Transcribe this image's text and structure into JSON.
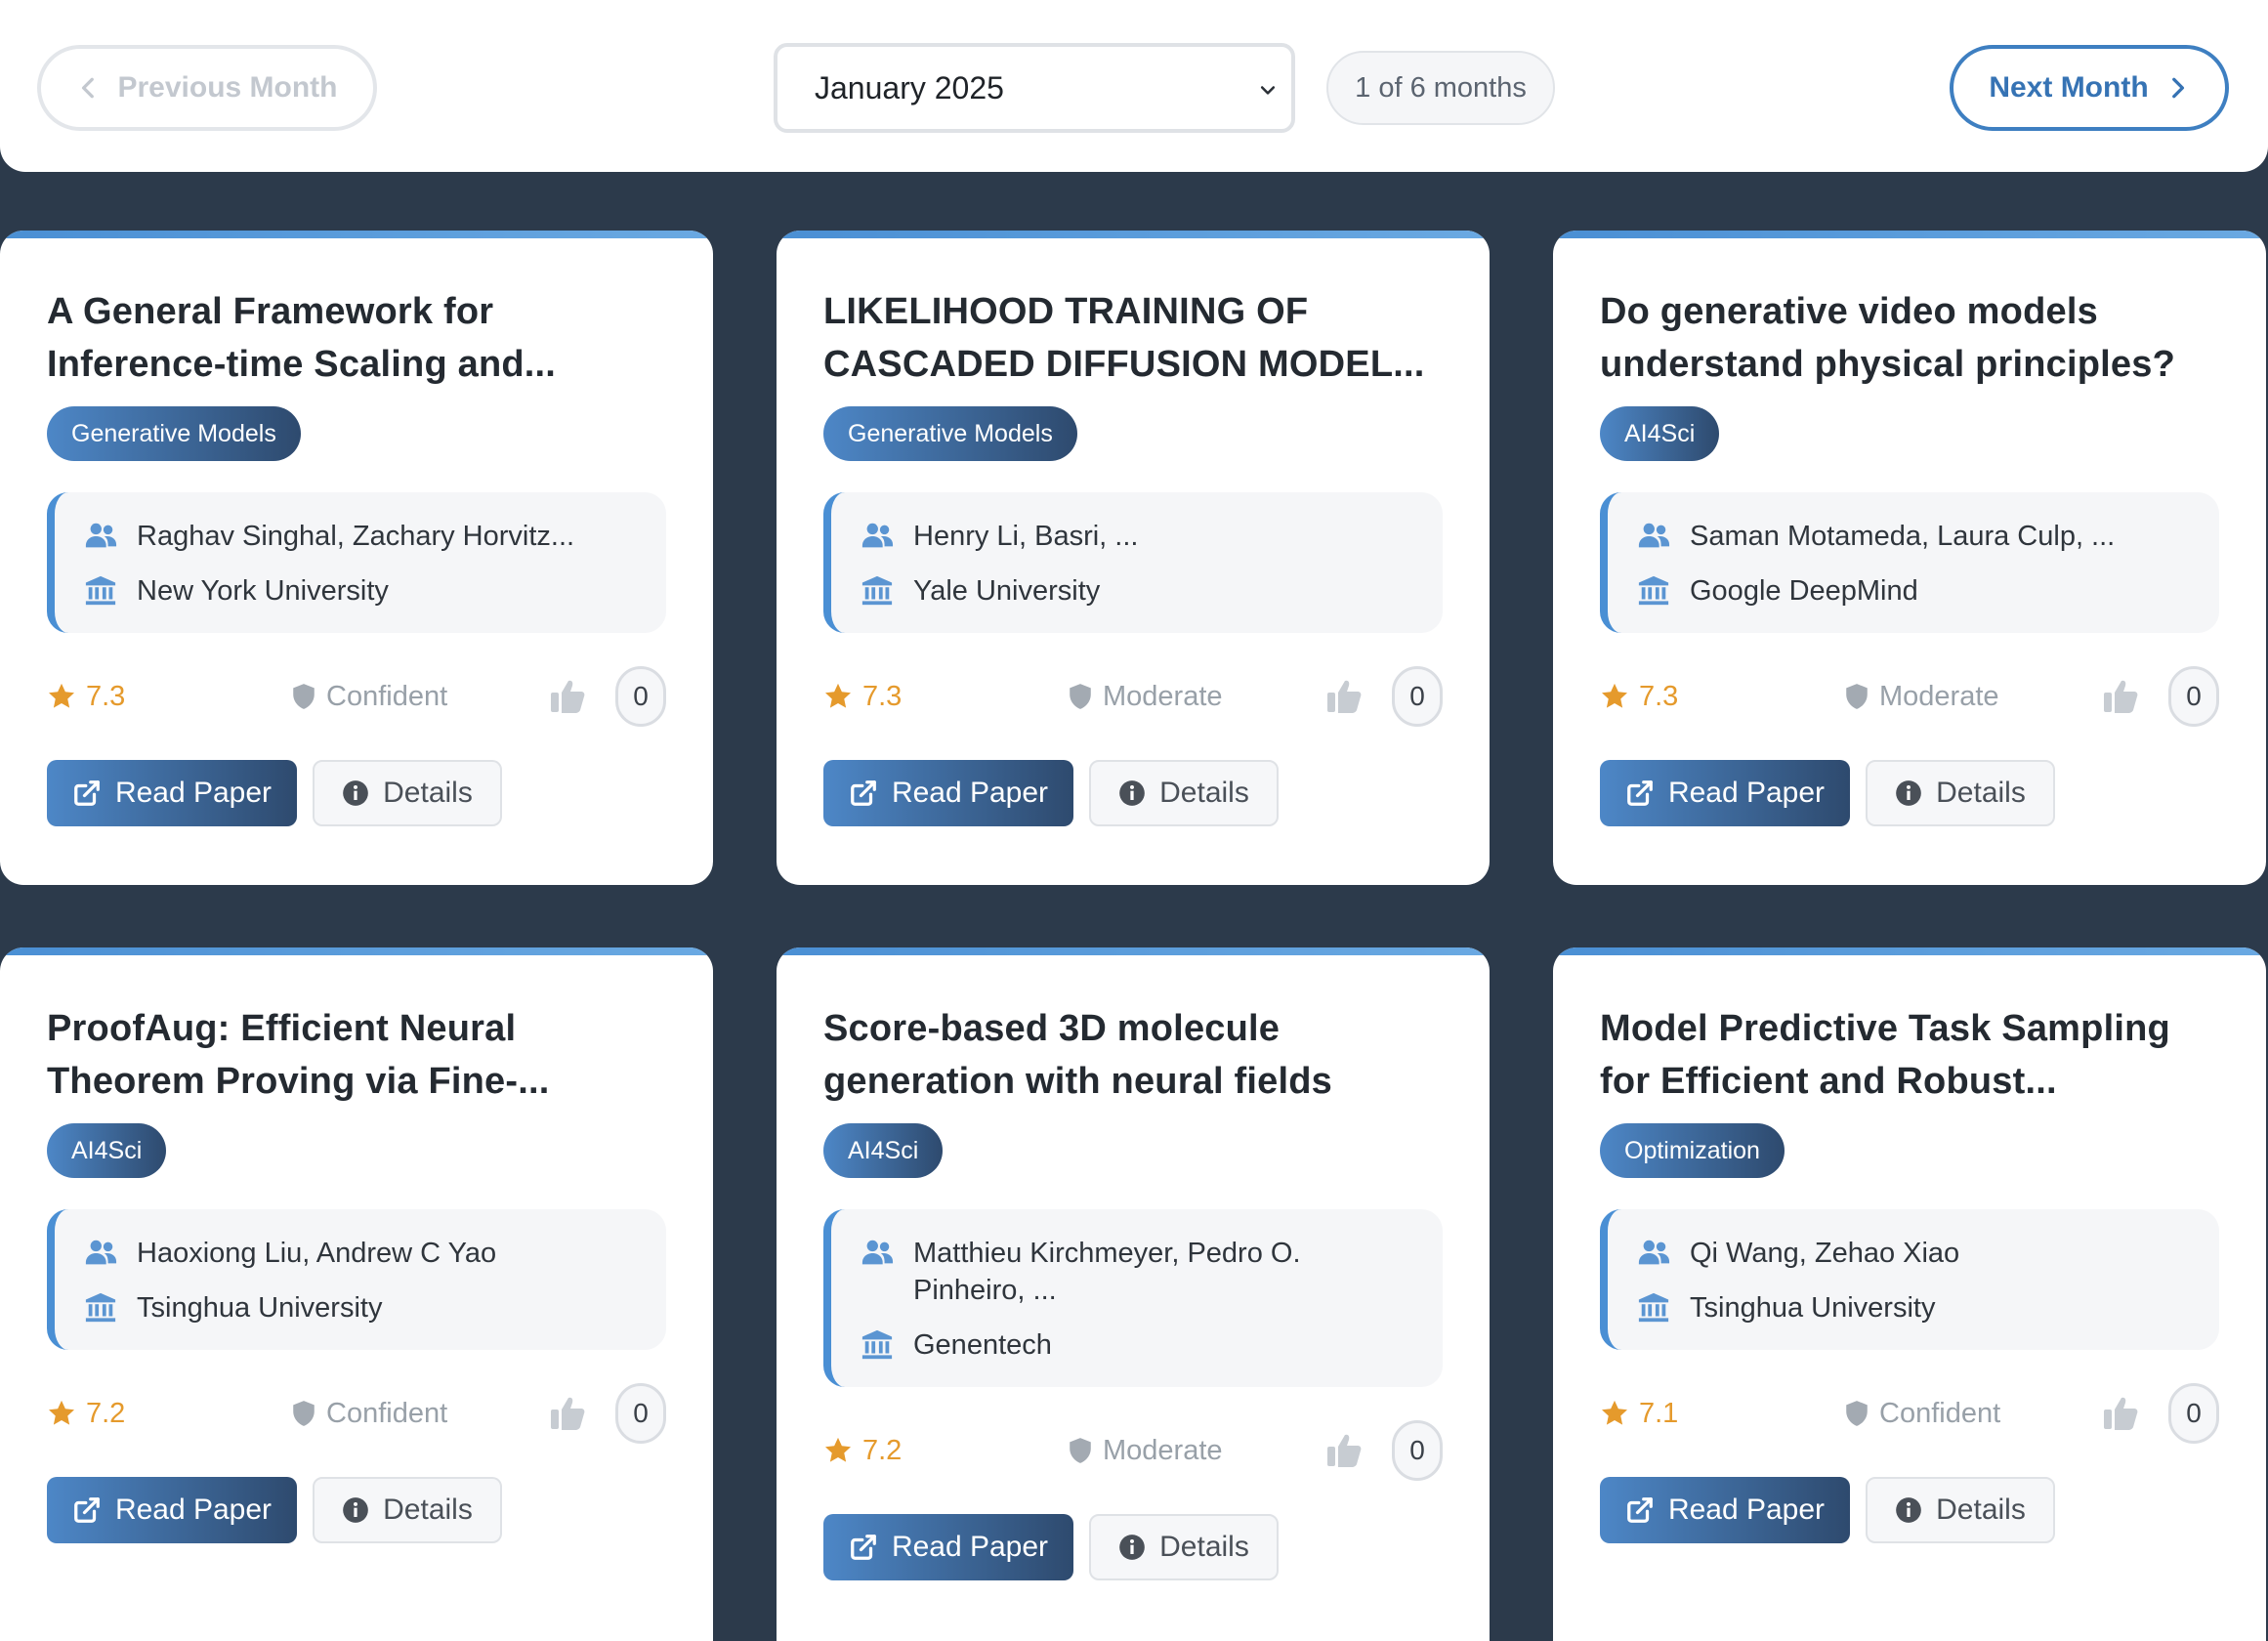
{
  "nav": {
    "prev_label": "Previous Month",
    "month_value": "January 2025",
    "month_count": "1 of 6 months",
    "next_label": "Next Month"
  },
  "colors": {
    "background": "#2c3a4b",
    "accent": "#4a8fd4",
    "rating": "#e59a2c"
  },
  "cards": [
    {
      "title": "A General Framework for Inference-time Scaling and...",
      "tag": "Generative Models",
      "authors": "Raghav Singhal, Zachary Horvitz...",
      "institution": "New York University",
      "rating": "7.3",
      "confidence": "Confident",
      "likes": "0",
      "read_label": "Read Paper",
      "details_label": "Details"
    },
    {
      "title": "LIKELIHOOD TRAINING OF CASCADED DIFFUSION MODEL...",
      "tag": "Generative Models",
      "authors": "Henry Li, Basri, ...",
      "institution": "Yale University",
      "rating": "7.3",
      "confidence": "Moderate",
      "likes": "0",
      "read_label": "Read Paper",
      "details_label": "Details"
    },
    {
      "title": "Do generative video models understand physical principles?",
      "tag": "AI4Sci",
      "authors": "Saman Motameda, Laura Culp, ...",
      "institution": "Google DeepMind",
      "rating": "7.3",
      "confidence": "Moderate",
      "likes": "0",
      "read_label": "Read Paper",
      "details_label": "Details"
    },
    {
      "title": "ProofAug: Efficient Neural Theorem Proving via Fine-...",
      "tag": "AI4Sci",
      "authors": "Haoxiong Liu, Andrew C Yao",
      "institution": "Tsinghua University",
      "rating": "7.2",
      "confidence": "Confident",
      "likes": "0",
      "read_label": "Read Paper",
      "details_label": "Details"
    },
    {
      "title": "Score-based 3D molecule generation with neural fields",
      "tag": "AI4Sci",
      "authors": "Matthieu Kirchmeyer, Pedro O. Pinheiro, ...",
      "institution": "Genentech",
      "rating": "7.2",
      "confidence": "Moderate",
      "likes": "0",
      "read_label": "Read Paper",
      "details_label": "Details"
    },
    {
      "title": "Model Predictive Task Sampling for Efficient and Robust...",
      "tag": "Optimization",
      "authors": "Qi Wang, Zehao Xiao",
      "institution": "Tsinghua University",
      "rating": "7.1",
      "confidence": "Confident",
      "likes": "0",
      "read_label": "Read Paper",
      "details_label": "Details"
    }
  ]
}
